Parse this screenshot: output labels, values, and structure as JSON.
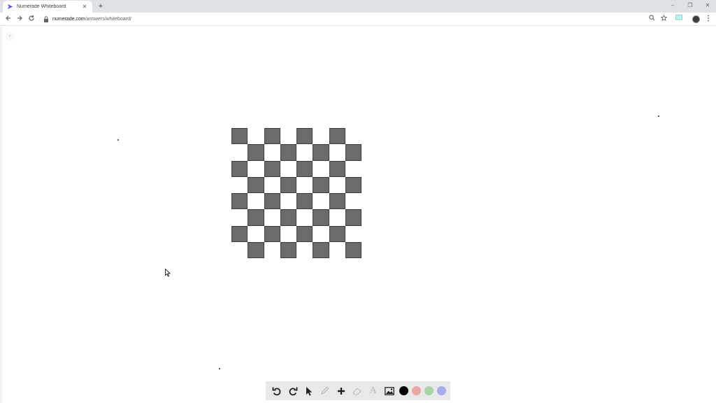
{
  "browser": {
    "tab_title": "Numerade Whiteboard",
    "tab_close": "✕",
    "new_tab": "+",
    "url_host": "numerade.com",
    "url_path": "/answers/whiteboard/",
    "window_controls": [
      "–",
      "❐",
      "✕"
    ]
  },
  "whiteboard": {
    "collapse_label": "‹",
    "checkerboard": {
      "rows": 8,
      "cols": 8,
      "filled_color": "#6b6b6b",
      "pattern": "diagonal-checker"
    }
  },
  "draw_toolbar": {
    "tools": [
      {
        "name": "undo-icon",
        "glyph": "↺"
      },
      {
        "name": "redo-icon",
        "glyph": "↻"
      },
      {
        "name": "select-arrow-icon",
        "glyph": ""
      },
      {
        "name": "pencil-icon",
        "glyph": "✎"
      },
      {
        "name": "plus-icon",
        "glyph": "✚"
      },
      {
        "name": "eraser-icon",
        "glyph": ""
      },
      {
        "name": "text-icon",
        "glyph": "A"
      },
      {
        "name": "image-icon",
        "glyph": ""
      }
    ],
    "colors": [
      "#000000",
      "#eba6a6",
      "#a9d4a5",
      "#aaaaf0"
    ]
  }
}
